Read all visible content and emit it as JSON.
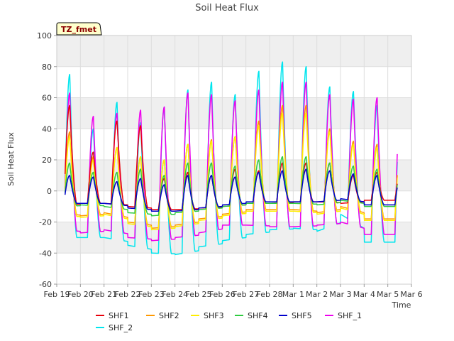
{
  "chart_data": {
    "type": "line",
    "title": "Soil Heat Flux",
    "xlabel": "Time",
    "ylabel": "Soil Heat Flux",
    "badge": "TZ_fmet",
    "ylim": [
      -60,
      100
    ],
    "yticks": [
      -60,
      -40,
      -20,
      0,
      20,
      40,
      60,
      80,
      100
    ],
    "xlim": [
      0,
      15
    ],
    "xticks": [
      {
        "x": 0,
        "label": "Feb 19"
      },
      {
        "x": 1,
        "label": "Feb 20"
      },
      {
        "x": 2,
        "label": "Feb 21"
      },
      {
        "x": 3,
        "label": "Feb 22"
      },
      {
        "x": 4,
        "label": "Feb 23"
      },
      {
        "x": 5,
        "label": "Feb 24"
      },
      {
        "x": 6,
        "label": "Feb 25"
      },
      {
        "x": 7,
        "label": "Feb 26"
      },
      {
        "x": 8,
        "label": "Feb 27"
      },
      {
        "x": 9,
        "label": "Feb 28"
      },
      {
        "x": 10,
        "label": "Mar 1"
      },
      {
        "x": 11,
        "label": "Mar 2"
      },
      {
        "x": 12,
        "label": "Mar 3"
      },
      {
        "x": 13,
        "label": "Mar 4"
      },
      {
        "x": 14,
        "label": "Mar 5"
      },
      {
        "x": 15,
        "label": "Mar 6"
      }
    ],
    "grid": true,
    "legend_position": "bottom",
    "x_start": 0.35,
    "x_end": 14.4,
    "series": [
      {
        "name": "SHF1",
        "color": "#e8000b",
        "peaks": [
          55,
          25,
          45,
          42,
          8,
          12,
          10,
          14,
          13,
          18,
          18,
          18,
          10,
          12
        ],
        "troughs": [
          -9,
          -8,
          -8,
          -10,
          -12,
          -12,
          -11,
          -10,
          -8,
          -8,
          -7,
          -7,
          -8,
          -6
        ]
      },
      {
        "name": "SHF2",
        "color": "#ff9900",
        "peaks": [
          38,
          22,
          28,
          22,
          20,
          30,
          33,
          35,
          45,
          55,
          55,
          40,
          32,
          30
        ],
        "troughs": [
          -15,
          -16,
          -14,
          -20,
          -24,
          -22,
          -18,
          -15,
          -12,
          -12,
          -12,
          -14,
          -10,
          -18
        ]
      },
      {
        "name": "SHF3",
        "color": "#ffee00",
        "peaks": [
          35,
          20,
          28,
          22,
          20,
          30,
          32,
          35,
          42,
          50,
          50,
          38,
          30,
          28
        ],
        "troughs": [
          -16,
          -17,
          -15,
          -21,
          -25,
          -23,
          -19,
          -16,
          -13,
          -13,
          -13,
          -15,
          -11,
          -19
        ]
      },
      {
        "name": "SHF4",
        "color": "#2ecc40",
        "peaks": [
          18,
          12,
          12,
          14,
          10,
          18,
          18,
          16,
          20,
          22,
          22,
          18,
          16,
          14
        ],
        "troughs": [
          -10,
          -9,
          -10,
          -14,
          -16,
          -14,
          -12,
          -10,
          -8,
          -8,
          -8,
          -9,
          -6,
          -10
        ]
      },
      {
        "name": "SHF5",
        "color": "#0000cc",
        "peaks": [
          10,
          9,
          6,
          8,
          4,
          10,
          10,
          9,
          12,
          13,
          14,
          13,
          11,
          10
        ],
        "troughs": [
          -8,
          -8,
          -8,
          -11,
          -13,
          -13,
          -11,
          -9,
          -7,
          -7,
          -7,
          -7,
          -5,
          -9
        ]
      },
      {
        "name": "SHF_1",
        "color": "#ee00ee",
        "peaks": [
          63,
          48,
          50,
          52,
          54,
          63,
          62,
          58,
          65,
          70,
          70,
          62,
          59,
          60
        ],
        "troughs": [
          -25,
          -27,
          -25,
          -30,
          -32,
          -30,
          -27,
          -22,
          -22,
          -23,
          -23,
          -22,
          -20,
          -28
        ]
      },
      {
        "name": "SHF_2",
        "color": "#00e5ee",
        "peaks": [
          75,
          40,
          57,
          44,
          54,
          65,
          70,
          62,
          77,
          83,
          80,
          67,
          64,
          55
        ],
        "troughs": [
          -30,
          -30,
          -30,
          -35,
          -40,
          -41,
          -36,
          -32,
          -28,
          -25,
          -24,
          -26,
          -15,
          -33
        ]
      }
    ]
  }
}
